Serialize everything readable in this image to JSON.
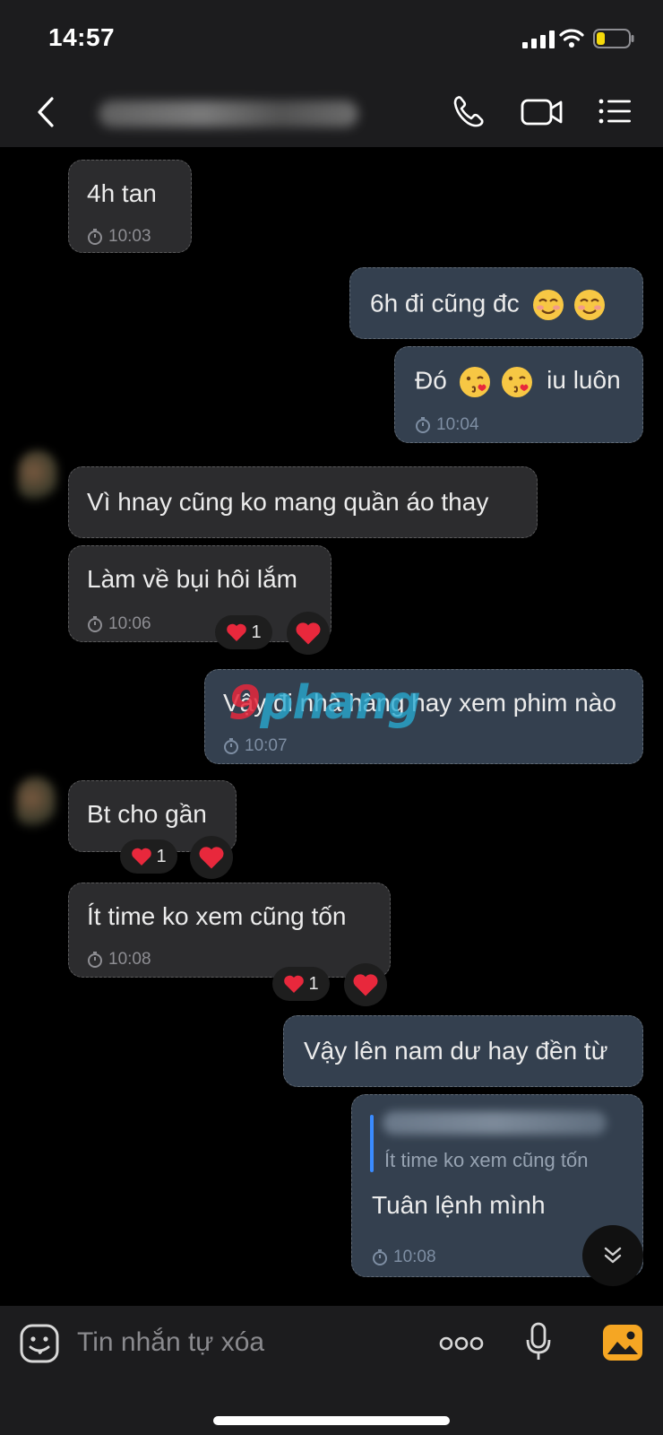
{
  "status_bar": {
    "time": "14:57"
  },
  "header": {
    "contact_name_blurred": ""
  },
  "messages": [
    {
      "text": "4h tan",
      "time": "10:03"
    },
    {
      "text": "6h đi cũng đc"
    },
    {
      "text_before": "Đó",
      "text_after": "iu luôn",
      "time": "10:04"
    },
    {
      "text": "Vì hnay cũng ko mang quần áo thay"
    },
    {
      "text": "Làm về bụi hôi lắm",
      "time": "10:06",
      "reaction_count": "1"
    },
    {
      "text": "Vậy đi nhà hàng hay xem phim nào",
      "time": "10:07"
    },
    {
      "text": "Bt cho gần",
      "reaction_count": "1"
    },
    {
      "text": "Ít time ko xem cũng tốn",
      "time": "10:08",
      "reaction_count": "1"
    },
    {
      "text": "Vậy lên nam dư hay đền từ"
    },
    {
      "quoted_text": "Ít time ko xem cũng tốn",
      "text": "Tuân lệnh mình",
      "time": "10:08"
    }
  ],
  "watermark": {
    "part1": "9",
    "part2": "phang"
  },
  "input": {
    "placeholder": "Tin nhắn tự xóa"
  },
  "icons": [
    "back-icon",
    "phone-icon",
    "video-icon",
    "menu-icon",
    "clock-icon",
    "heart-icon",
    "sticker-icon",
    "more-icon",
    "mic-icon",
    "gallery-icon",
    "scroll-down-icon"
  ],
  "colors": {
    "incoming_bubble": "#2c2c2e",
    "outgoing_bubble": "#34404f",
    "heart": "#e8283c",
    "gallery": "#f5a623"
  }
}
